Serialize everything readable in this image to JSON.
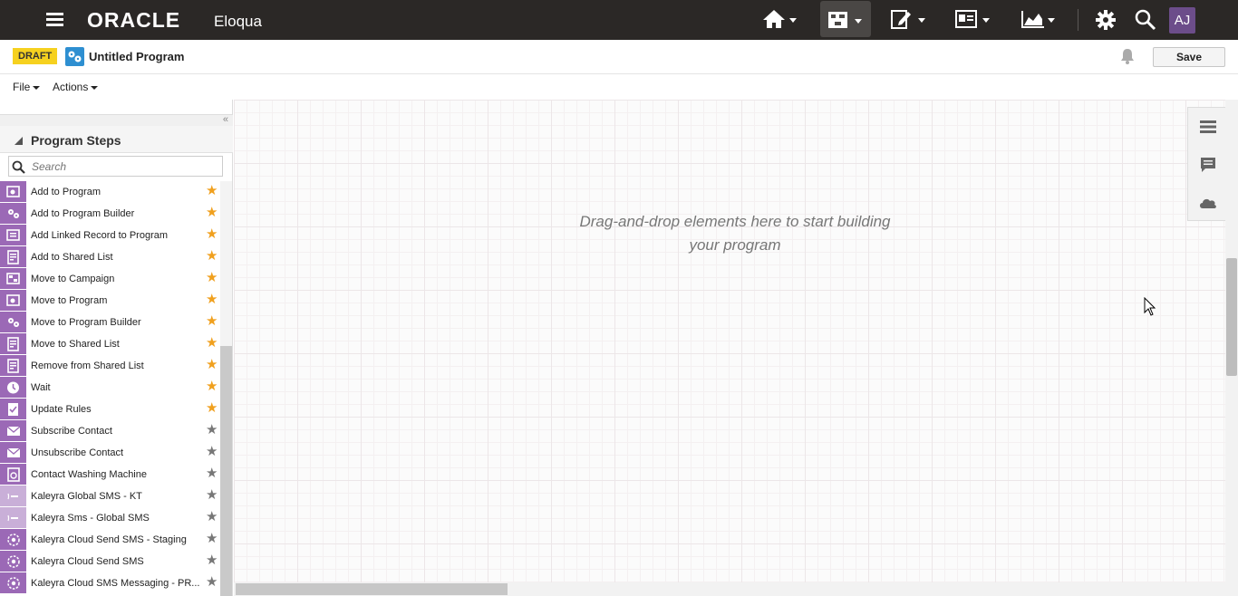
{
  "topbar": {
    "brand": "ORACLE",
    "product": "Eloqua",
    "nav_icons": [
      "home-icon",
      "campaigns-icon",
      "assets-icon",
      "contacts-icon",
      "analytics-icon"
    ],
    "right_icons": [
      "settings-icon",
      "search-icon"
    ],
    "avatar_initials": "AJ",
    "background": "#2b2826",
    "avatar_color": "#6c4d8a"
  },
  "titlebar": {
    "status_badge": "DRAFT",
    "program_title": "Untitled Program",
    "save_label": "Save"
  },
  "menubar": {
    "file_label": "File",
    "actions_label": "Actions"
  },
  "panel": {
    "title": "Program Steps",
    "search_placeholder": "Search",
    "collapse_glyph": "«",
    "steps": [
      {
        "label": "Add to Program",
        "icon": "program-icon",
        "starred": true
      },
      {
        "label": "Add to Program Builder",
        "icon": "program-builder-icon",
        "starred": true
      },
      {
        "label": "Add Linked Record to Program",
        "icon": "linked-record-icon",
        "starred": true
      },
      {
        "label": "Add to Shared List",
        "icon": "shared-list-icon",
        "starred": true
      },
      {
        "label": "Move to Campaign",
        "icon": "campaign-icon",
        "starred": true
      },
      {
        "label": "Move to Program",
        "icon": "program-icon",
        "starred": true
      },
      {
        "label": "Move to Program Builder",
        "icon": "program-builder-icon",
        "starred": true
      },
      {
        "label": "Move to Shared List",
        "icon": "shared-list-icon",
        "starred": true
      },
      {
        "label": "Remove from Shared List",
        "icon": "shared-list-icon",
        "starred": true
      },
      {
        "label": "Wait",
        "icon": "clock-icon",
        "starred": true
      },
      {
        "label": "Update Rules",
        "icon": "rules-icon",
        "starred": true
      },
      {
        "label": "Subscribe Contact",
        "icon": "envelope-icon",
        "starred": false
      },
      {
        "label": "Unsubscribe Contact",
        "icon": "envelope-icon",
        "starred": false
      },
      {
        "label": "Contact Washing Machine",
        "icon": "washing-machine-icon",
        "starred": false
      },
      {
        "label": "Kaleyra Global SMS - KT",
        "icon": "sms-icon",
        "starred": false
      },
      {
        "label": "Kaleyra Sms - Global SMS",
        "icon": "sms-icon",
        "starred": false
      },
      {
        "label": "Kaleyra Cloud Send SMS - Staging",
        "icon": "cloud-app-icon",
        "starred": false
      },
      {
        "label": "Kaleyra Cloud Send SMS",
        "icon": "cloud-app-icon",
        "starred": false
      },
      {
        "label": "Kaleyra Cloud SMS Messaging - PR...",
        "icon": "cloud-app-icon",
        "starred": false
      }
    ],
    "step_icon_color": "#9b69b6",
    "star_on_color": "#f0a01e",
    "star_off_color": "#777777"
  },
  "canvas": {
    "hint_line1": "Drag-and-drop elements here to start building",
    "hint_line2": "your program",
    "tools": [
      "list-icon",
      "comment-icon",
      "cloud-icon"
    ]
  }
}
